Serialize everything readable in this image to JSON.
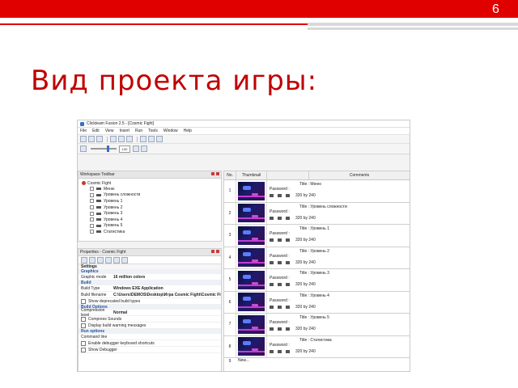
{
  "slide": {
    "number": "6",
    "title": "Вид проекта игры:"
  },
  "app": {
    "window_title": "Clickteam Fusion 2.5 - [Cosmic Fight]",
    "menu": [
      "File",
      "Edit",
      "View",
      "Insert",
      "Run",
      "Tools",
      "Window",
      "Help"
    ],
    "zoom_value": "100"
  },
  "workspace": {
    "title": "Workspace Toolbar",
    "root": "Cosmic Fight",
    "frames": [
      "Меню",
      "Уровень сложности",
      "Уровень 1",
      "Уровень 2",
      "Уровень 3",
      "Уровень 4",
      "Уровень 5",
      "Статистика"
    ]
  },
  "properties": {
    "title": "Properties - Cosmic Fight",
    "settings_label": "Settings",
    "graphics_label": "Graphics",
    "graphic_mode_key": "Graphic mode",
    "graphic_mode_value": "16 million colors",
    "build_label": "Build",
    "build_type_key": "Build Type",
    "build_type_value": "Windows EXE Application",
    "build_filename_key": "Build filename",
    "build_filename_value": "C:\\Users\\DEMOS\\Desktop\\Игра Cosmic Fight\\Cosmic Fi",
    "show_deprecated": "Show deprecated build types",
    "build_options_label": "Build Options",
    "compression_key": "Compression level",
    "compression_value": "Normal",
    "compress_sounds": "Compress Sounds",
    "display_warnings": "Display build warning messages",
    "run_options_label": "Run options",
    "command_line": "Command line",
    "enable_debugger": "Enable debugger keyboard shortcuts",
    "show_debugger": "Show Debugger"
  },
  "storyboard": {
    "headers": {
      "no": "No.",
      "thumbnail": "Thumbnail",
      "comments": "Comments"
    },
    "password_label": "Password :",
    "size_label": "320 by 240",
    "frames": [
      {
        "no": "1",
        "title": "Title : Меню"
      },
      {
        "no": "2",
        "title": "Title : Уровень сложности"
      },
      {
        "no": "3",
        "title": "Title : Уровень 1"
      },
      {
        "no": "4",
        "title": "Title : Уровень 2"
      },
      {
        "no": "5",
        "title": "Title : Уровень 3"
      },
      {
        "no": "6",
        "title": "Title : Уровень 4"
      },
      {
        "no": "7",
        "title": "Title : Уровень 5"
      },
      {
        "no": "8",
        "title": "Title : Статистика"
      }
    ],
    "next_no": "9",
    "next_label": "New..."
  },
  "colors": {
    "accent_red": "#e00000",
    "title_red": "#c00000"
  }
}
